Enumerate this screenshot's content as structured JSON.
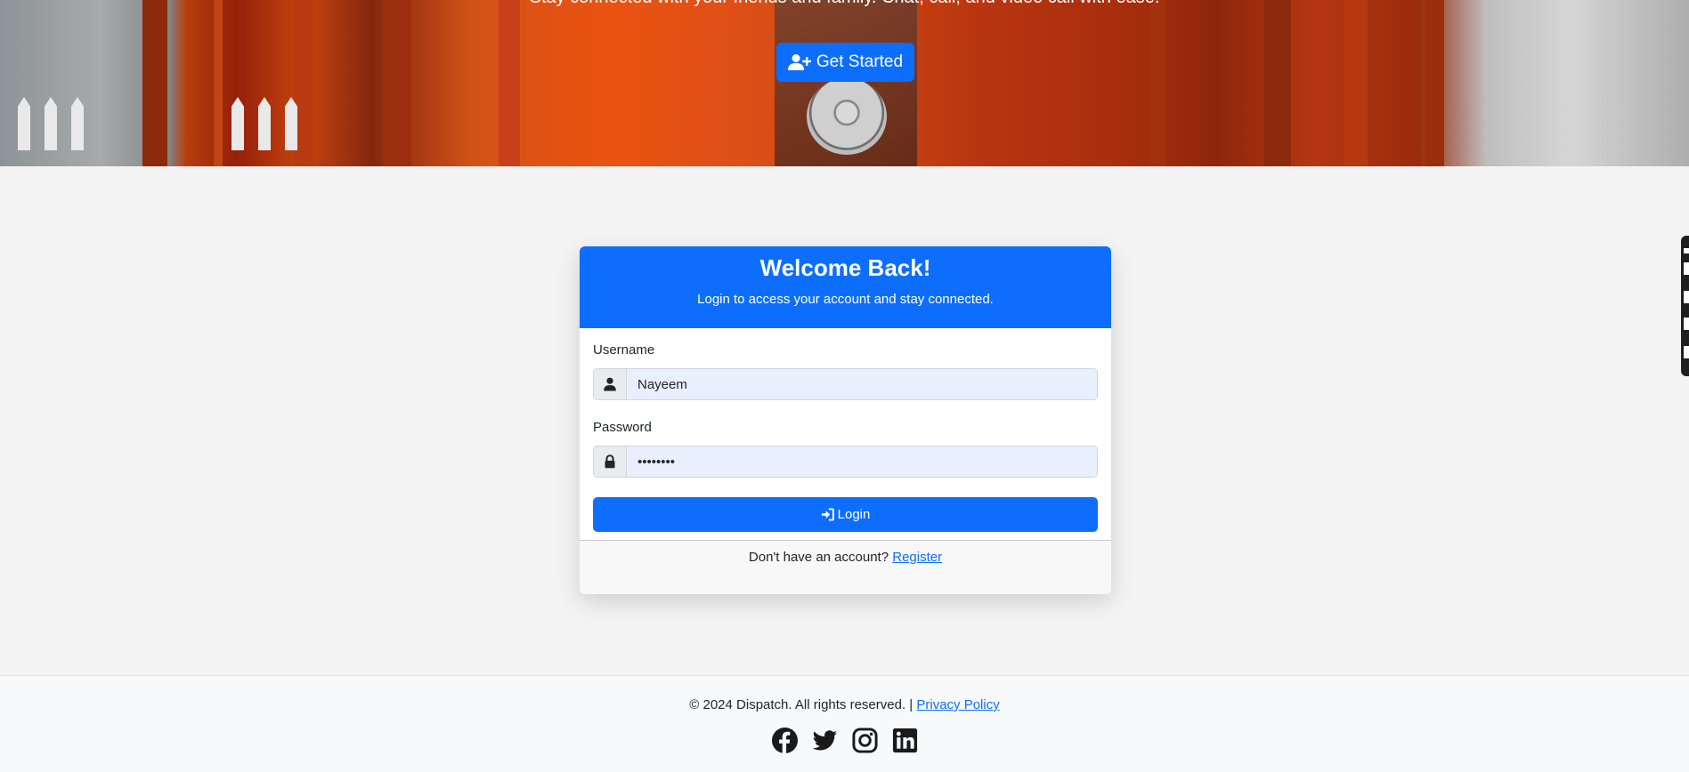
{
  "hero": {
    "tagline": "Stay connected with your friends and family. Chat, call, and video call with ease.",
    "get_started_label": "Get Started"
  },
  "login_card": {
    "title": "Welcome Back!",
    "subtitle": "Login to access your account and stay connected.",
    "username_label": "Username",
    "username_value": "Nayeem",
    "password_label": "Password",
    "password_value": "••••••••",
    "login_label": "Login",
    "footer_text": "Don't have an account?",
    "register_label": "Register"
  },
  "footer": {
    "copyright": "© 2024 Dispatch. All rights reserved. |",
    "privacy_label": "Privacy Policy",
    "socials": [
      "facebook-icon",
      "twitter-icon",
      "instagram-icon",
      "linkedin-icon"
    ]
  },
  "colors": {
    "primary": "#0d6efd",
    "background": "#f4f4f4"
  }
}
